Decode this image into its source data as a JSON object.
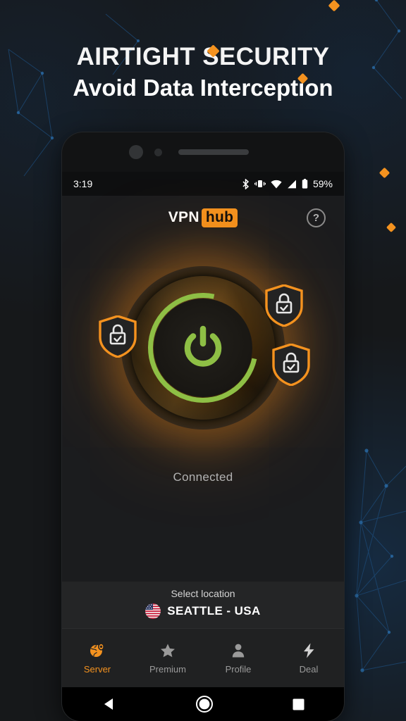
{
  "headline": {
    "line1": "AIRTIGHT SECURITY",
    "line2": "Avoid Data Interception"
  },
  "colors": {
    "accent_orange": "#f4921f",
    "ring_green": "#8ebf45",
    "power_key_mint": "#7fdcb4",
    "page_background": "#16181a",
    "screen_background": "#1b1c1e"
  },
  "phone": {
    "hardware": {
      "camera_icon": "camera-dot",
      "speaker_icon": "speaker-grille",
      "power_key": "power-key",
      "volume_key": "volume-rocker"
    },
    "status_bar": {
      "time": "3:19",
      "battery_percent": "59%",
      "icons": [
        "bluetooth-icon",
        "vibrate-icon",
        "wifi-icon",
        "cellular-signal-icon",
        "battery-icon"
      ]
    },
    "app_header": {
      "logo_primary": "VPN",
      "logo_badge": "hub",
      "help_label": "?"
    },
    "vpn_status": {
      "state_label": "Connected",
      "power_icon": "power-icon",
      "shield_icons": [
        "shield-lock-icon",
        "shield-lock-icon",
        "shield-lock-icon"
      ]
    },
    "location": {
      "label": "Select location",
      "flag_icon": "usa-flag-icon",
      "name": "SEATTLE - USA"
    },
    "tabs": [
      {
        "label": "Server",
        "icon": "globe-pin-icon",
        "active": true
      },
      {
        "label": "Premium",
        "icon": "star-icon",
        "active": false
      },
      {
        "label": "Profile",
        "icon": "person-icon",
        "active": false
      },
      {
        "label": "Deal",
        "icon": "bolt-icon",
        "active": false
      }
    ],
    "nav_bar": {
      "back": "back-triangle-icon",
      "home": "home-circle-icon",
      "recents": "recents-square-icon"
    }
  }
}
